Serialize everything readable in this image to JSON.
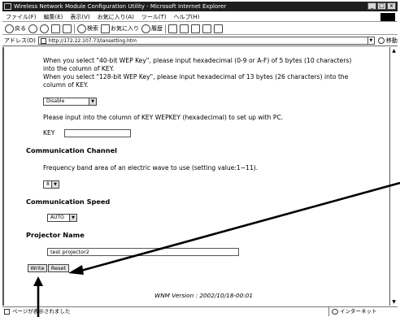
{
  "window": {
    "title": "Wireless Network Module Configuration Utility - Microsoft Internet Explorer",
    "controls": [
      "_",
      "□",
      "x"
    ]
  },
  "menubar": [
    "ファイル(F)",
    "編集(E)",
    "表示(V)",
    "お気に入り(A)",
    "ツール(T)",
    "ヘルプ(H)"
  ],
  "toolbar": {
    "back": "戻る",
    "search": "検索",
    "favorites": "お気に入り",
    "history": "履歴"
  },
  "addressbar": {
    "label": "アドレス(D)",
    "url": "http://172.22.107.73/lansetting.htm",
    "go": "移動"
  },
  "wep": {
    "line1": "When you select \"40-bit WEP Key\", please input hexadecimal (0-9 or A-F) of 5 bytes (10 characters)",
    "line2": "into the column of KEY.",
    "line3": "When you select \"128-bit WEP Key\", please input hexadecimal of 13 bytes (26 characters) into the",
    "line4": "column of KEY.",
    "select_value": "Disable",
    "key_instruction": "Please input into the column of KEY WEPKEY (hexadecimal) to set up with PC.",
    "key_label": "KEY",
    "key_value": ""
  },
  "channel": {
    "heading": "Communication Channel",
    "description": "Frequency band area of an electric wave to use (setting value:1~11).",
    "value": "8"
  },
  "speed": {
    "heading": "Communication Speed",
    "value": "AUTO"
  },
  "projector": {
    "heading": "Projector Name",
    "value": "test projector2"
  },
  "buttons": {
    "write": "Write",
    "reset": "Reset"
  },
  "footer": {
    "version": "WNM Version : 2002/10/18-00:01"
  },
  "statusbar": {
    "status": "ページが表示されました",
    "zone": "インターネット"
  }
}
